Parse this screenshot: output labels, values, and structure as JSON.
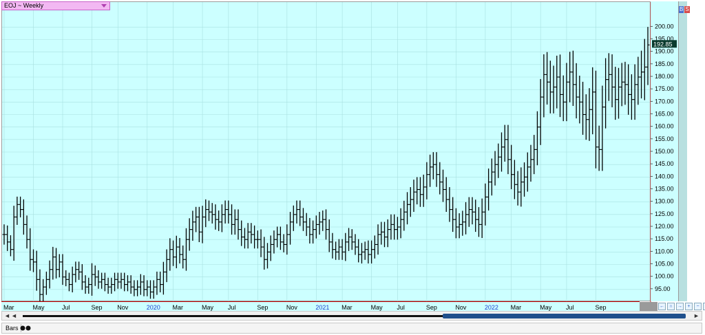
{
  "window": {
    "symbol": "EOJ ~ Weekly"
  },
  "side": {
    "buy_label": "B",
    "sell_label": "S"
  },
  "nav": {
    "buttons": [
      "←",
      "∩",
      "→",
      "+",
      "−",
      "⇔"
    ]
  },
  "scroll": {
    "left_label": "◄",
    "right_label": "►"
  },
  "status": {
    "label": "Bars"
  },
  "icons": {
    "symbol_dropdown": "chevron-down-icon",
    "bars_toggle": "toggle-icon"
  },
  "colors": {
    "plot_bg": "#ccffff",
    "bar": "#000000",
    "last_price_bg": "#0b3b2e",
    "last_price_fg": "#ffffff",
    "cursor_line": "#c00000"
  },
  "chart_data": {
    "type": "bar",
    "style": "ohlc",
    "title": "EOJ ~ Weekly",
    "ylim": [
      90,
      210
    ],
    "y_ticks": [
      95,
      100,
      105,
      110,
      115,
      120,
      125,
      130,
      135,
      140,
      145,
      150,
      155,
      160,
      165,
      170,
      175,
      180,
      185,
      190,
      195,
      200
    ],
    "y_tick_labels": [
      "95.00",
      "100.00",
      "105.00",
      "110.00",
      "115.00",
      "120.00",
      "125.00",
      "130.00",
      "135.00",
      "140.00",
      "145.00",
      "150.00",
      "155.00",
      "160.00",
      "165.00",
      "170.00",
      "175.00",
      "180.00",
      "185.00",
      "190.00",
      "195.00",
      "200.00"
    ],
    "last_price": "192.85",
    "last_value": 192.85,
    "x_ticks": [
      {
        "label": "Mar",
        "week": 0
      },
      {
        "label": "May",
        "week": 9
      },
      {
        "label": "Jul",
        "week": 18
      },
      {
        "label": "Sep",
        "week": 27
      },
      {
        "label": "Nov",
        "week": 35
      },
      {
        "label": "2020",
        "week": 44,
        "highlight": true
      },
      {
        "label": "Mar",
        "week": 52
      },
      {
        "label": "May",
        "week": 61
      },
      {
        "label": "Jul",
        "week": 69
      },
      {
        "label": "Sep",
        "week": 78
      },
      {
        "label": "Nov",
        "week": 87
      },
      {
        "label": "2021",
        "week": 96,
        "highlight": true
      },
      {
        "label": "Mar",
        "week": 104
      },
      {
        "label": "May",
        "week": 113
      },
      {
        "label": "Jul",
        "week": 121
      },
      {
        "label": "Sep",
        "week": 130
      },
      {
        "label": "Nov",
        "week": 139
      },
      {
        "label": "2022",
        "week": 148,
        "highlight": true
      },
      {
        "label": "Mar",
        "week": 156
      },
      {
        "label": "May",
        "week": 165
      },
      {
        "label": "Jul",
        "week": 173
      },
      {
        "label": "Sep",
        "week": 182
      }
    ],
    "closes": [
      117,
      114,
      111,
      124,
      129,
      127,
      121,
      115,
      107,
      106,
      99,
      93,
      96,
      99,
      103,
      108,
      103,
      106,
      100,
      99,
      97,
      101,
      103,
      102,
      98,
      96,
      97,
      101,
      100,
      98,
      99,
      97,
      96,
      97,
      99,
      98,
      99,
      97,
      98,
      96,
      95,
      96,
      98,
      95,
      96,
      94,
      96,
      99,
      97,
      102,
      107,
      111,
      108,
      112,
      109,
      107,
      115,
      119,
      122,
      124,
      118,
      124,
      127,
      126,
      125,
      123,
      122,
      125,
      127,
      125,
      121,
      123,
      119,
      116,
      115,
      118,
      117,
      115,
      115,
      112,
      107,
      110,
      113,
      115,
      117,
      114,
      113,
      117,
      122,
      125,
      127,
      124,
      122,
      120,
      117,
      119,
      121,
      122,
      123,
      119,
      114,
      111,
      110,
      112,
      110,
      114,
      116,
      114,
      112,
      109,
      110,
      111,
      109,
      111,
      113,
      117,
      118,
      116,
      119,
      121,
      119,
      120,
      123,
      126,
      129,
      131,
      134,
      135,
      133,
      136,
      141,
      144,
      145,
      141,
      138,
      135,
      131,
      127,
      123,
      120,
      121,
      122,
      125,
      127,
      126,
      123,
      121,
      126,
      132,
      138,
      142,
      145,
      148,
      152,
      155,
      147,
      141,
      137,
      134,
      138,
      140,
      144,
      147,
      151,
      160,
      172,
      181,
      178,
      174,
      176,
      180,
      173,
      170,
      178,
      182,
      177,
      172,
      170,
      165,
      163,
      167,
      174,
      152,
      151,
      168,
      179,
      181,
      176,
      171,
      176,
      178,
      177,
      173,
      171,
      177,
      180,
      182,
      184,
      192.85
    ],
    "spread": [
      9,
      8,
      6,
      10,
      7,
      7,
      9,
      8,
      10,
      9,
      10,
      9,
      7,
      7,
      8,
      9,
      8,
      7,
      7,
      6,
      6,
      7,
      7,
      7,
      7,
      6,
      6,
      10,
      8,
      6,
      6,
      6,
      6,
      6,
      6,
      6,
      6,
      6,
      6,
      6,
      6,
      6,
      7,
      6,
      6,
      6,
      6,
      7,
      7,
      9,
      9,
      10,
      8,
      10,
      8,
      8,
      10,
      10,
      10,
      9,
      9,
      10,
      9,
      8,
      8,
      9,
      8,
      9,
      8,
      8,
      9,
      9,
      9,
      8,
      8,
      8,
      8,
      8,
      8,
      9,
      9,
      8,
      8,
      8,
      7,
      7,
      7,
      9,
      9,
      8,
      8,
      8,
      8,
      8,
      8,
      8,
      8,
      9,
      8,
      9,
      9,
      8,
      7,
      7,
      7,
      8,
      8,
      7,
      7,
      7,
      8,
      7,
      8,
      8,
      8,
      9,
      9,
      9,
      9,
      9,
      9,
      9,
      10,
      10,
      11,
      11,
      11,
      11,
      11,
      11,
      11,
      11,
      11,
      11,
      11,
      11,
      11,
      11,
      11,
      10,
      10,
      10,
      11,
      11,
      11,
      11,
      11,
      12,
      12,
      12,
      12,
      12,
      12,
      13,
      13,
      13,
      13,
      13,
      12,
      13,
      13,
      13,
      13,
      13,
      14,
      16,
      18,
      20,
      19,
      19,
      19,
      20,
      17,
      17,
      18,
      19,
      19,
      19,
      18,
      18,
      19,
      22,
      19,
      19,
      19,
      19,
      19,
      18,
      18,
      17,
      17,
      18,
      18,
      18,
      18,
      18,
      19,
      25,
      16
    ]
  }
}
